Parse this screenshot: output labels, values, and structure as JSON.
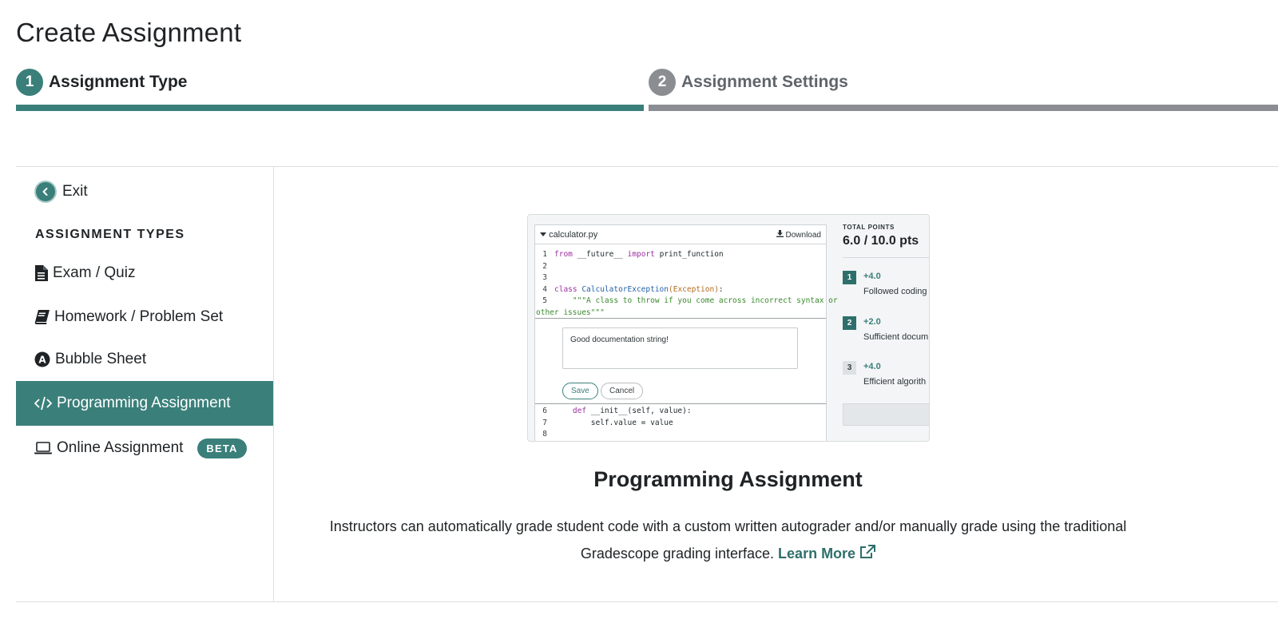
{
  "page": {
    "title": "Create Assignment"
  },
  "stepper": {
    "steps": [
      {
        "number": "1",
        "label": "Assignment Type"
      },
      {
        "number": "2",
        "label": "Assignment Settings"
      }
    ]
  },
  "sidebar": {
    "exit_label": "Exit",
    "heading": "ASSIGNMENT TYPES",
    "items": [
      {
        "label": "Exam / Quiz",
        "icon": "document-icon"
      },
      {
        "label": "Homework / Problem Set",
        "icon": "book-icon"
      },
      {
        "label": "Bubble Sheet",
        "icon": "bubble-a-icon"
      },
      {
        "label": "Programming Assignment",
        "icon": "code-icon"
      },
      {
        "label": "Online Assignment",
        "icon": "laptop-icon",
        "badge": "BETA"
      }
    ]
  },
  "preview": {
    "filename": "calculator.py",
    "download_label": "Download",
    "code_lines": [
      {
        "n": "1",
        "kw": "from",
        "mid": " __future__ ",
        "kw2": "import",
        "rest": " print_function"
      },
      {
        "n": "2"
      },
      {
        "n": "3"
      },
      {
        "n": "4",
        "kw": "class",
        "cls": " CalculatorException",
        "exc": "(Exception)",
        "rest": ":"
      },
      {
        "n": "5",
        "str": "    \"\"\"A class to throw if you come across incorrect syntax or"
      }
    ],
    "line5_cont": "other issues\"\"\"",
    "comment": "Good documentation string!",
    "save_label": "Save",
    "cancel_label": "Cancel",
    "code_lines_2": [
      {
        "n": "6",
        "kw": "    def",
        "rest": " __init__(self, value):"
      },
      {
        "n": "7",
        "rest": "        self.value = value"
      },
      {
        "n": "8",
        "rest": ""
      }
    ],
    "total_points_label": "TOTAL POINTS",
    "total_points_value": "6.0 / 10.0 pts",
    "rubric": [
      {
        "n": "1",
        "pts": "+4.0",
        "desc": "Followed coding"
      },
      {
        "n": "2",
        "pts": "+2.0",
        "desc": "Sufficient docum"
      },
      {
        "n": "3",
        "pts": "+4.0",
        "desc": "Efficient algorith"
      }
    ]
  },
  "feature": {
    "title": "Programming Assignment",
    "description": "Instructors can automatically grade student code with a custom written autograder and/or manually grade using the traditional Gradescope grading interface. ",
    "learn_more": "Learn More"
  },
  "colors": {
    "accent": "#3a7f7a",
    "inactive": "#8a8e92",
    "text": "#1f2326"
  }
}
